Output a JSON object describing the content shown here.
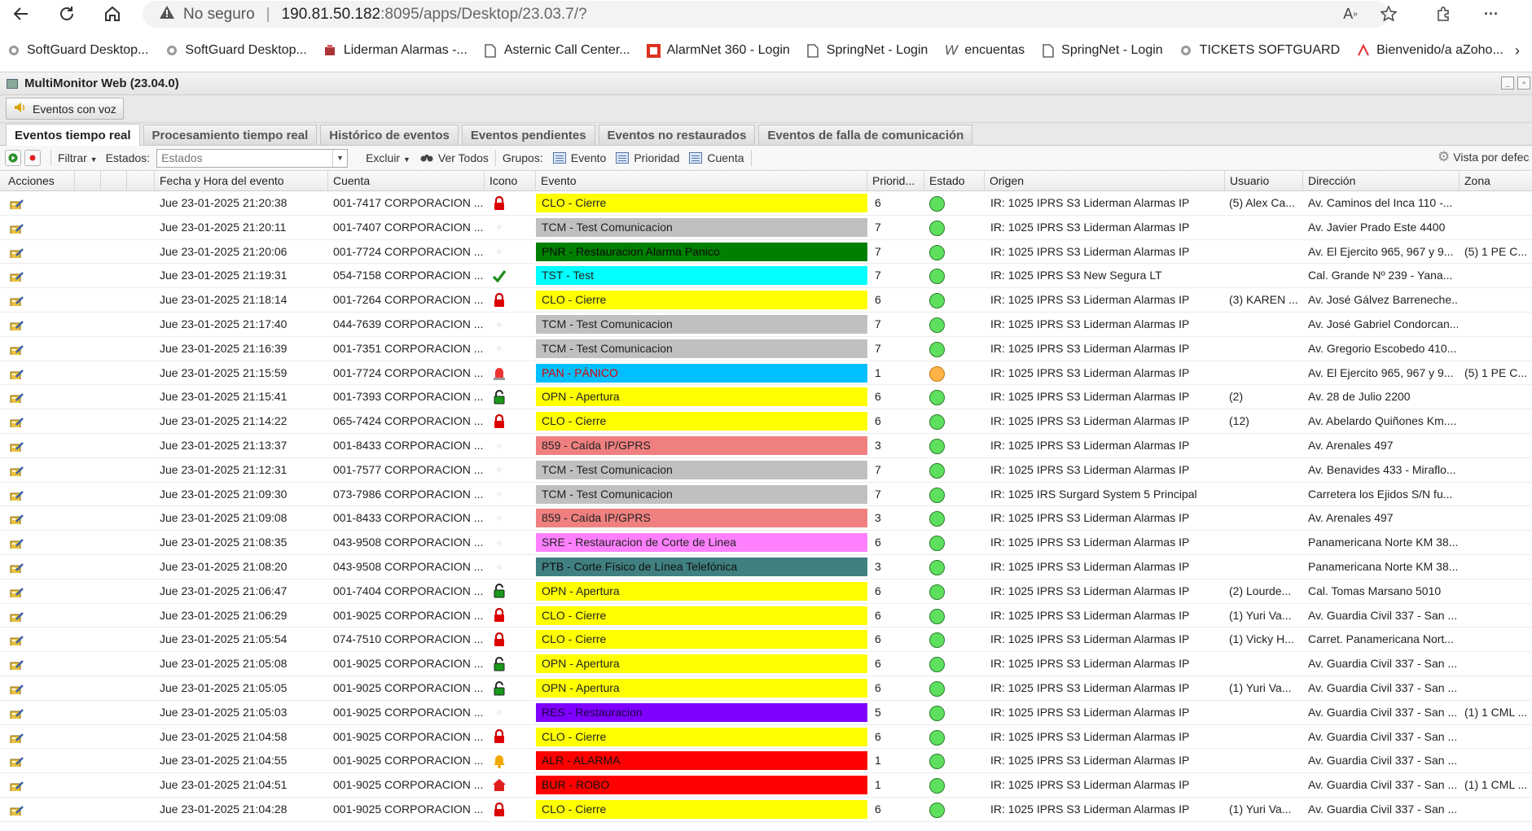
{
  "browser": {
    "security_label": "No seguro",
    "url_host": "190.81.50.182",
    "url_path": ":8095/apps/Desktop/23.03.7/?"
  },
  "bookmarks": [
    {
      "label": "SoftGuard Desktop...",
      "icon": "softguard-icon"
    },
    {
      "label": "SoftGuard Desktop...",
      "icon": "softguard-icon"
    },
    {
      "label": "Liderman Alarmas -...",
      "icon": "liderman-icon"
    },
    {
      "label": "Asternic Call Center...",
      "icon": "page-icon"
    },
    {
      "label": "AlarmNet 360 - Login",
      "icon": "alarmnet-icon"
    },
    {
      "label": "SpringNet - Login",
      "icon": "page-icon"
    },
    {
      "label": "encuentas",
      "icon": "w-icon"
    },
    {
      "label": "SpringNet - Login",
      "icon": "page-icon"
    },
    {
      "label": "TICKETS SOFTGUARD",
      "icon": "softguard-icon"
    },
    {
      "label": "Bienvenido/a aZoho...",
      "icon": "zoho-icon"
    }
  ],
  "app": {
    "title": "MultiMonitor Web (23.04.0)",
    "voice_button": "Eventos con voz",
    "tabs": [
      "Eventos tiempo real",
      "Procesamiento tiempo real",
      "Histórico de eventos",
      "Eventos pendientes",
      "Eventos no restaurados",
      "Eventos de falla de comunicación"
    ],
    "toolbar": {
      "filtrar": "Filtrar",
      "estados_label": "Estados:",
      "estados_placeholder": "Estados",
      "excluir": "Excluir",
      "ver_todos": "Ver Todos",
      "grupos_label": "Grupos:",
      "evento": "Evento",
      "prioridad": "Prioridad",
      "cuenta": "Cuenta",
      "vista": "Vista por defec"
    },
    "columns": [
      "Acciones",
      "Fecha y Hora del evento",
      "Cuenta",
      "Icono",
      "Evento",
      "Priorid...",
      "Estado",
      "Origen",
      "Usuario",
      "Dirección",
      "Zona"
    ]
  },
  "colors": {
    "CLO": "#ffff00",
    "TCM": "#c0c0c0",
    "PNR": "#008000",
    "TST": "#00ffff",
    "PAN": "#00bfff",
    "OPN": "#ffff00",
    "859": "#f08080",
    "SRE": "#ff80ff",
    "PTB": "#408080",
    "RES": "#8000ff",
    "ALR": "#ff0000",
    "BUR": "#ff0000",
    "status_green": "#5ee05e",
    "status_orange": "#ffb347"
  },
  "rows": [
    {
      "fecha": "Jue 23-01-2025 21:20:38",
      "cuenta": "001-7417 CORPORACION ...",
      "icon": "lock-red",
      "code": "CLO",
      "evento": "CLO - Cierre",
      "prio": "6",
      "estado": "green",
      "origen": "IR: 1025 IPRS S3 Liderman Alarmas IP",
      "usuario": "(5) Alex Ca...",
      "direccion": "Av. Caminos del Inca 110 -...",
      "zona": ""
    },
    {
      "fecha": "Jue 23-01-2025 21:20:11",
      "cuenta": "001-7407 CORPORACION ...",
      "icon": "none",
      "code": "TCM",
      "evento": "TCM - Test Comunicacion",
      "prio": "7",
      "estado": "green",
      "origen": "IR: 1025 IPRS S3 Liderman Alarmas IP",
      "usuario": "",
      "direccion": "Av. Javier Prado Este 4400",
      "zona": ""
    },
    {
      "fecha": "Jue 23-01-2025 21:20:06",
      "cuenta": "001-7724 CORPORACION ...",
      "icon": "none",
      "code": "PNR",
      "evento": "PNR - Restauracion Alarma Panico",
      "prio": "7",
      "estado": "green",
      "origen": "IR: 1025 IPRS S3 Liderman Alarmas IP",
      "usuario": "",
      "direccion": "Av. El Ejercito 965, 967 y 9...",
      "zona": "(5) 1 PE C..."
    },
    {
      "fecha": "Jue 23-01-2025 21:19:31",
      "cuenta": "054-7158 CORPORACION ...",
      "icon": "check",
      "code": "TST",
      "evento": "TST - Test",
      "prio": "7",
      "estado": "green",
      "origen": "IR: 1025 IPRS S3 New Segura LT",
      "usuario": "",
      "direccion": "Cal. Grande Nº 239 - Yana...",
      "zona": ""
    },
    {
      "fecha": "Jue 23-01-2025 21:18:14",
      "cuenta": "001-7264 CORPORACION ...",
      "icon": "lock-red",
      "code": "CLO",
      "evento": "CLO - Cierre",
      "prio": "6",
      "estado": "green",
      "origen": "IR: 1025 IPRS S3 Liderman Alarmas IP",
      "usuario": "(3) KAREN ...",
      "direccion": "Av. José Gálvez Barreneche...",
      "zona": ""
    },
    {
      "fecha": "Jue 23-01-2025 21:17:40",
      "cuenta": "044-7639 CORPORACION ...",
      "icon": "none",
      "code": "TCM",
      "evento": "TCM - Test Comunicacion",
      "prio": "7",
      "estado": "green",
      "origen": "IR: 1025 IPRS S3 Liderman Alarmas IP",
      "usuario": "",
      "direccion": "Av. José Gabriel Condorcan...",
      "zona": ""
    },
    {
      "fecha": "Jue 23-01-2025 21:16:39",
      "cuenta": "001-7351 CORPORACION ...",
      "icon": "none",
      "code": "TCM",
      "evento": "TCM - Test Comunicacion",
      "prio": "7",
      "estado": "green",
      "origen": "IR: 1025 IPRS S3 Liderman Alarmas IP",
      "usuario": "",
      "direccion": "Av. Gregorio Escobedo 410...",
      "zona": ""
    },
    {
      "fecha": "Jue 23-01-2025 21:15:59",
      "cuenta": "001-7724 CORPORACION ...",
      "icon": "siren",
      "code": "PAN",
      "evento": "PAN - PÁNICO",
      "prio": "1",
      "estado": "orange",
      "origen": "IR: 1025 IPRS S3 Liderman Alarmas IP",
      "usuario": "",
      "direccion": "Av. El Ejercito 965, 967 y 9...",
      "zona": "(5) 1 PE C..."
    },
    {
      "fecha": "Jue 23-01-2025 21:15:41",
      "cuenta": "001-7393 CORPORACION ...",
      "icon": "lock-green",
      "code": "OPN",
      "evento": "OPN - Apertura",
      "prio": "6",
      "estado": "green",
      "origen": "IR: 1025 IPRS S3 Liderman Alarmas IP",
      "usuario": "(2)",
      "direccion": "Av. 28 de Julio 2200",
      "zona": ""
    },
    {
      "fecha": "Jue 23-01-2025 21:14:22",
      "cuenta": "065-7424 CORPORACION ...",
      "icon": "lock-red",
      "code": "CLO",
      "evento": "CLO - Cierre",
      "prio": "6",
      "estado": "green",
      "origen": "IR: 1025 IPRS S3 Liderman Alarmas IP",
      "usuario": "(12)",
      "direccion": "Av. Abelardo Quiñones Km....",
      "zona": ""
    },
    {
      "fecha": "Jue 23-01-2025 21:13:37",
      "cuenta": "001-8433 CORPORACION ...",
      "icon": "none",
      "code": "859",
      "evento": "859 - Caída IP/GPRS",
      "prio": "3",
      "estado": "green",
      "origen": "IR: 1025 IPRS S3 Liderman Alarmas IP",
      "usuario": "",
      "direccion": "Av. Arenales 497",
      "zona": ""
    },
    {
      "fecha": "Jue 23-01-2025 21:12:31",
      "cuenta": "001-7577 CORPORACION ...",
      "icon": "none",
      "code": "TCM",
      "evento": "TCM - Test Comunicacion",
      "prio": "7",
      "estado": "green",
      "origen": "IR: 1025 IPRS S3 Liderman Alarmas IP",
      "usuario": "",
      "direccion": "Av. Benavides 433 - Miraflo...",
      "zona": ""
    },
    {
      "fecha": "Jue 23-01-2025 21:09:30",
      "cuenta": "073-7986 CORPORACION ...",
      "icon": "none",
      "code": "TCM",
      "evento": "TCM - Test Comunicacion",
      "prio": "7",
      "estado": "green",
      "origen": "IR: 1025 IRS Surgard System 5 Principal",
      "usuario": "",
      "direccion": "Carretera los Ejidos S/N fu...",
      "zona": ""
    },
    {
      "fecha": "Jue 23-01-2025 21:09:08",
      "cuenta": "001-8433 CORPORACION ...",
      "icon": "none",
      "code": "859",
      "evento": "859 - Caída IP/GPRS",
      "prio": "3",
      "estado": "green",
      "origen": "IR: 1025 IPRS S3 Liderman Alarmas IP",
      "usuario": "",
      "direccion": "Av. Arenales 497",
      "zona": ""
    },
    {
      "fecha": "Jue 23-01-2025 21:08:35",
      "cuenta": "043-9508 CORPORACION ...",
      "icon": "none",
      "code": "SRE",
      "evento": "SRE - Restauracion de Corte de Linea",
      "prio": "6",
      "estado": "green",
      "origen": "IR: 1025 IPRS S3 Liderman Alarmas IP",
      "usuario": "",
      "direccion": "Panamericana Norte KM 38...",
      "zona": ""
    },
    {
      "fecha": "Jue 23-01-2025 21:08:20",
      "cuenta": "043-9508 CORPORACION ...",
      "icon": "none",
      "code": "PTB",
      "evento": "PTB - Corte Físico de Línea Telefónica",
      "prio": "3",
      "estado": "green",
      "origen": "IR: 1025 IPRS S3 Liderman Alarmas IP",
      "usuario": "",
      "direccion": "Panamericana Norte KM 38...",
      "zona": ""
    },
    {
      "fecha": "Jue 23-01-2025 21:06:47",
      "cuenta": "001-7404 CORPORACION ...",
      "icon": "lock-green",
      "code": "OPN",
      "evento": "OPN - Apertura",
      "prio": "6",
      "estado": "green",
      "origen": "IR: 1025 IPRS S3 Liderman Alarmas IP",
      "usuario": "(2) Lourde...",
      "direccion": "Cal. Tomas Marsano 5010",
      "zona": ""
    },
    {
      "fecha": "Jue 23-01-2025 21:06:29",
      "cuenta": "001-9025 CORPORACION ...",
      "icon": "lock-red",
      "code": "CLO",
      "evento": "CLO - Cierre",
      "prio": "6",
      "estado": "green",
      "origen": "IR: 1025 IPRS S3 Liderman Alarmas IP",
      "usuario": "(1) Yuri Va...",
      "direccion": "Av. Guardia Civil 337 - San ...",
      "zona": ""
    },
    {
      "fecha": "Jue 23-01-2025 21:05:54",
      "cuenta": "074-7510 CORPORACION ...",
      "icon": "lock-red",
      "code": "CLO",
      "evento": "CLO - Cierre",
      "prio": "6",
      "estado": "green",
      "origen": "IR: 1025 IPRS S3 Liderman Alarmas IP",
      "usuario": "(1) Vicky H...",
      "direccion": "Carret. Panamericana Nort...",
      "zona": ""
    },
    {
      "fecha": "Jue 23-01-2025 21:05:08",
      "cuenta": "001-9025 CORPORACION ...",
      "icon": "lock-green",
      "code": "OPN",
      "evento": "OPN - Apertura",
      "prio": "6",
      "estado": "green",
      "origen": "IR: 1025 IPRS S3 Liderman Alarmas IP",
      "usuario": "",
      "direccion": "Av. Guardia Civil 337 - San ...",
      "zona": ""
    },
    {
      "fecha": "Jue 23-01-2025 21:05:05",
      "cuenta": "001-9025 CORPORACION ...",
      "icon": "lock-green",
      "code": "OPN",
      "evento": "OPN - Apertura",
      "prio": "6",
      "estado": "green",
      "origen": "IR: 1025 IPRS S3 Liderman Alarmas IP",
      "usuario": "(1) Yuri Va...",
      "direccion": "Av. Guardia Civil 337 - San ...",
      "zona": ""
    },
    {
      "fecha": "Jue 23-01-2025 21:05:03",
      "cuenta": "001-9025 CORPORACION ...",
      "icon": "none",
      "code": "RES",
      "evento": "RES - Restauracion",
      "prio": "5",
      "estado": "green",
      "origen": "IR: 1025 IPRS S3 Liderman Alarmas IP",
      "usuario": "",
      "direccion": "Av. Guardia Civil 337 - San ...",
      "zona": "(1) 1 CML ..."
    },
    {
      "fecha": "Jue 23-01-2025 21:04:58",
      "cuenta": "001-9025 CORPORACION ...",
      "icon": "lock-red",
      "code": "CLO",
      "evento": "CLO - Cierre",
      "prio": "6",
      "estado": "green",
      "origen": "IR: 1025 IPRS S3 Liderman Alarmas IP",
      "usuario": "",
      "direccion": "Av. Guardia Civil 337 - San ...",
      "zona": ""
    },
    {
      "fecha": "Jue 23-01-2025 21:04:55",
      "cuenta": "001-9025 CORPORACION ...",
      "icon": "bell",
      "code": "ALR",
      "evento": "ALR - ALARMA",
      "prio": "1",
      "estado": "green",
      "origen": "IR: 1025 IPRS S3 Liderman Alarmas IP",
      "usuario": "",
      "direccion": "Av. Guardia Civil 337 - San ...",
      "zona": ""
    },
    {
      "fecha": "Jue 23-01-2025 21:04:51",
      "cuenta": "001-9025 CORPORACION ...",
      "icon": "house",
      "code": "BUR",
      "evento": "BUR - ROBO",
      "prio": "1",
      "estado": "green",
      "origen": "IR: 1025 IPRS S3 Liderman Alarmas IP",
      "usuario": "",
      "direccion": "Av. Guardia Civil 337 - San ...",
      "zona": "(1) 1 CML ..."
    },
    {
      "fecha": "Jue 23-01-2025 21:04:28",
      "cuenta": "001-9025 CORPORACION ...",
      "icon": "lock-red",
      "code": "CLO",
      "evento": "CLO - Cierre",
      "prio": "6",
      "estado": "green",
      "origen": "IR: 1025 IPRS S3 Liderman Alarmas IP",
      "usuario": "(1) Yuri Va...",
      "direccion": "Av. Guardia Civil 337 - San ...",
      "zona": ""
    }
  ]
}
